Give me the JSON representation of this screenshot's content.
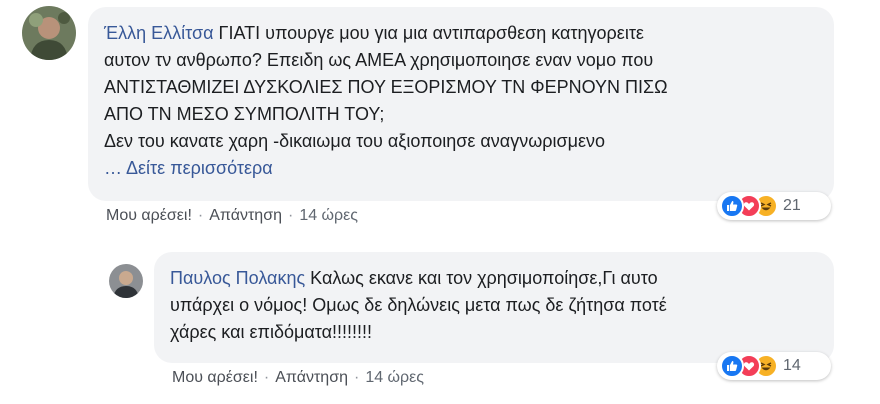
{
  "comment1": {
    "author": "Έλλη Ελλίτσα",
    "lines": [
      "ΓΙΑΤΙ υπουργε μου για μια αντιπαρσθεση κατηγορειτε",
      "αυτον τν ανθρωπο? Επειδη ως ΑΜΕΑ χρησιμοποιησε εναν νομο που",
      "ΑΝΤΙΣΤΑΘΜΙΖΕΙ ΔΥΣΚΟΛΙΕΣ ΠΟΥ ΕΞΟΡΙΣΜΟΥ ΤΝ ΦΕΡΝΟΥΝ ΠΙΣΩ",
      "ΑΠΟ ΤΝ ΜΕΣΟ ΣΥΜΠΟΛΙΤΗ ΤΟΥ;",
      "Δεν του κανατε χαρη -δικαιωμα του αξιοποιησε αναγνωρισμενο"
    ],
    "see_more": "… Δείτε περισσότερα",
    "like": "Μου αρέσει!",
    "reply": "Απάντηση",
    "time": "14 ώρες",
    "reaction_count": "21",
    "reaction_icons": [
      "like-icon",
      "love-icon",
      "haha-icon"
    ]
  },
  "reply1": {
    "author": "Παυλος Πολακης",
    "first_line": "Καλως εκανε και τον χρησιμοποίησε,Γι αυτο",
    "lines": [
      "υπάρχει ο νόμος! Ομως δε δηλώνεις μετα πως δε ζήτησα ποτέ",
      "χάρες και επιδόματα!!!!!!!!"
    ],
    "like": "Μου αρέσει!",
    "reply": "Απάντηση",
    "time": "14 ώρες",
    "reaction_count": "14",
    "reaction_icons": [
      "like-icon",
      "love-icon",
      "haha-icon"
    ]
  },
  "colors": {
    "author_link": "#385898",
    "bubble_bg": "#f2f3f5",
    "like_blue": "#1877f2",
    "love_red": "#f33e58",
    "haha_yellow": "#f7b125"
  }
}
